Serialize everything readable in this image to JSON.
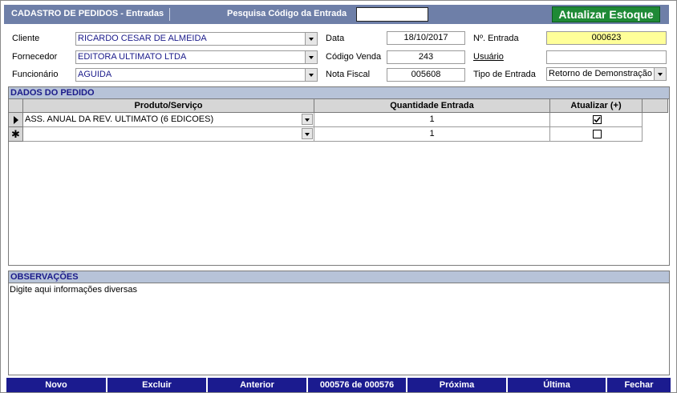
{
  "header": {
    "title": "CADASTRO DE PEDIDOS -  Entradas",
    "search_label": "Pesquisa Código da Entrada",
    "search_value": "",
    "stock_button": "Atualizar Estoque"
  },
  "form": {
    "cliente_label": "Cliente",
    "cliente_value": "RICARDO CESAR DE ALMEIDA",
    "fornecedor_label": "Fornecedor",
    "fornecedor_value": "EDITORA ULTIMATO LTDA",
    "funcionario_label": "Funcionário",
    "funcionario_value": "AGUIDA",
    "data_label": "Data",
    "data_value": "18/10/2017",
    "codigo_venda_label": "Código Venda",
    "codigo_venda_value": "243",
    "nota_fiscal_label": "Nota Fiscal",
    "nota_fiscal_value": "005608",
    "numero_entrada_label": "Nº. Entrada",
    "numero_entrada_value": "000623",
    "usuario_label": "Usuário",
    "usuario_value": "",
    "tipo_entrada_label": "Tipo de Entrada",
    "tipo_entrada_value": "Retorno de Demonstração"
  },
  "pedido": {
    "section_title": "DADOS DO PEDIDO",
    "columns": [
      "Produto/Serviço",
      "Quantidade Entrada",
      "Atualizar (+)"
    ],
    "rows": [
      {
        "produto": "ASS. ANUAL DA REV. ULTIMATO (6 EDICOES)",
        "quantidade": "1",
        "atualizar": true
      },
      {
        "produto": "",
        "quantidade": "1",
        "atualizar": false
      }
    ]
  },
  "observacoes": {
    "section_title": "OBSERVAÇÕES",
    "text": "Digite aqui informações diversas"
  },
  "nav": {
    "novo": "Novo",
    "excluir": "Excluir",
    "anterior": "Anterior",
    "record": "000576 de 000576",
    "proxima": "Próxima",
    "ultima": "Última",
    "fechar": "Fechar"
  }
}
